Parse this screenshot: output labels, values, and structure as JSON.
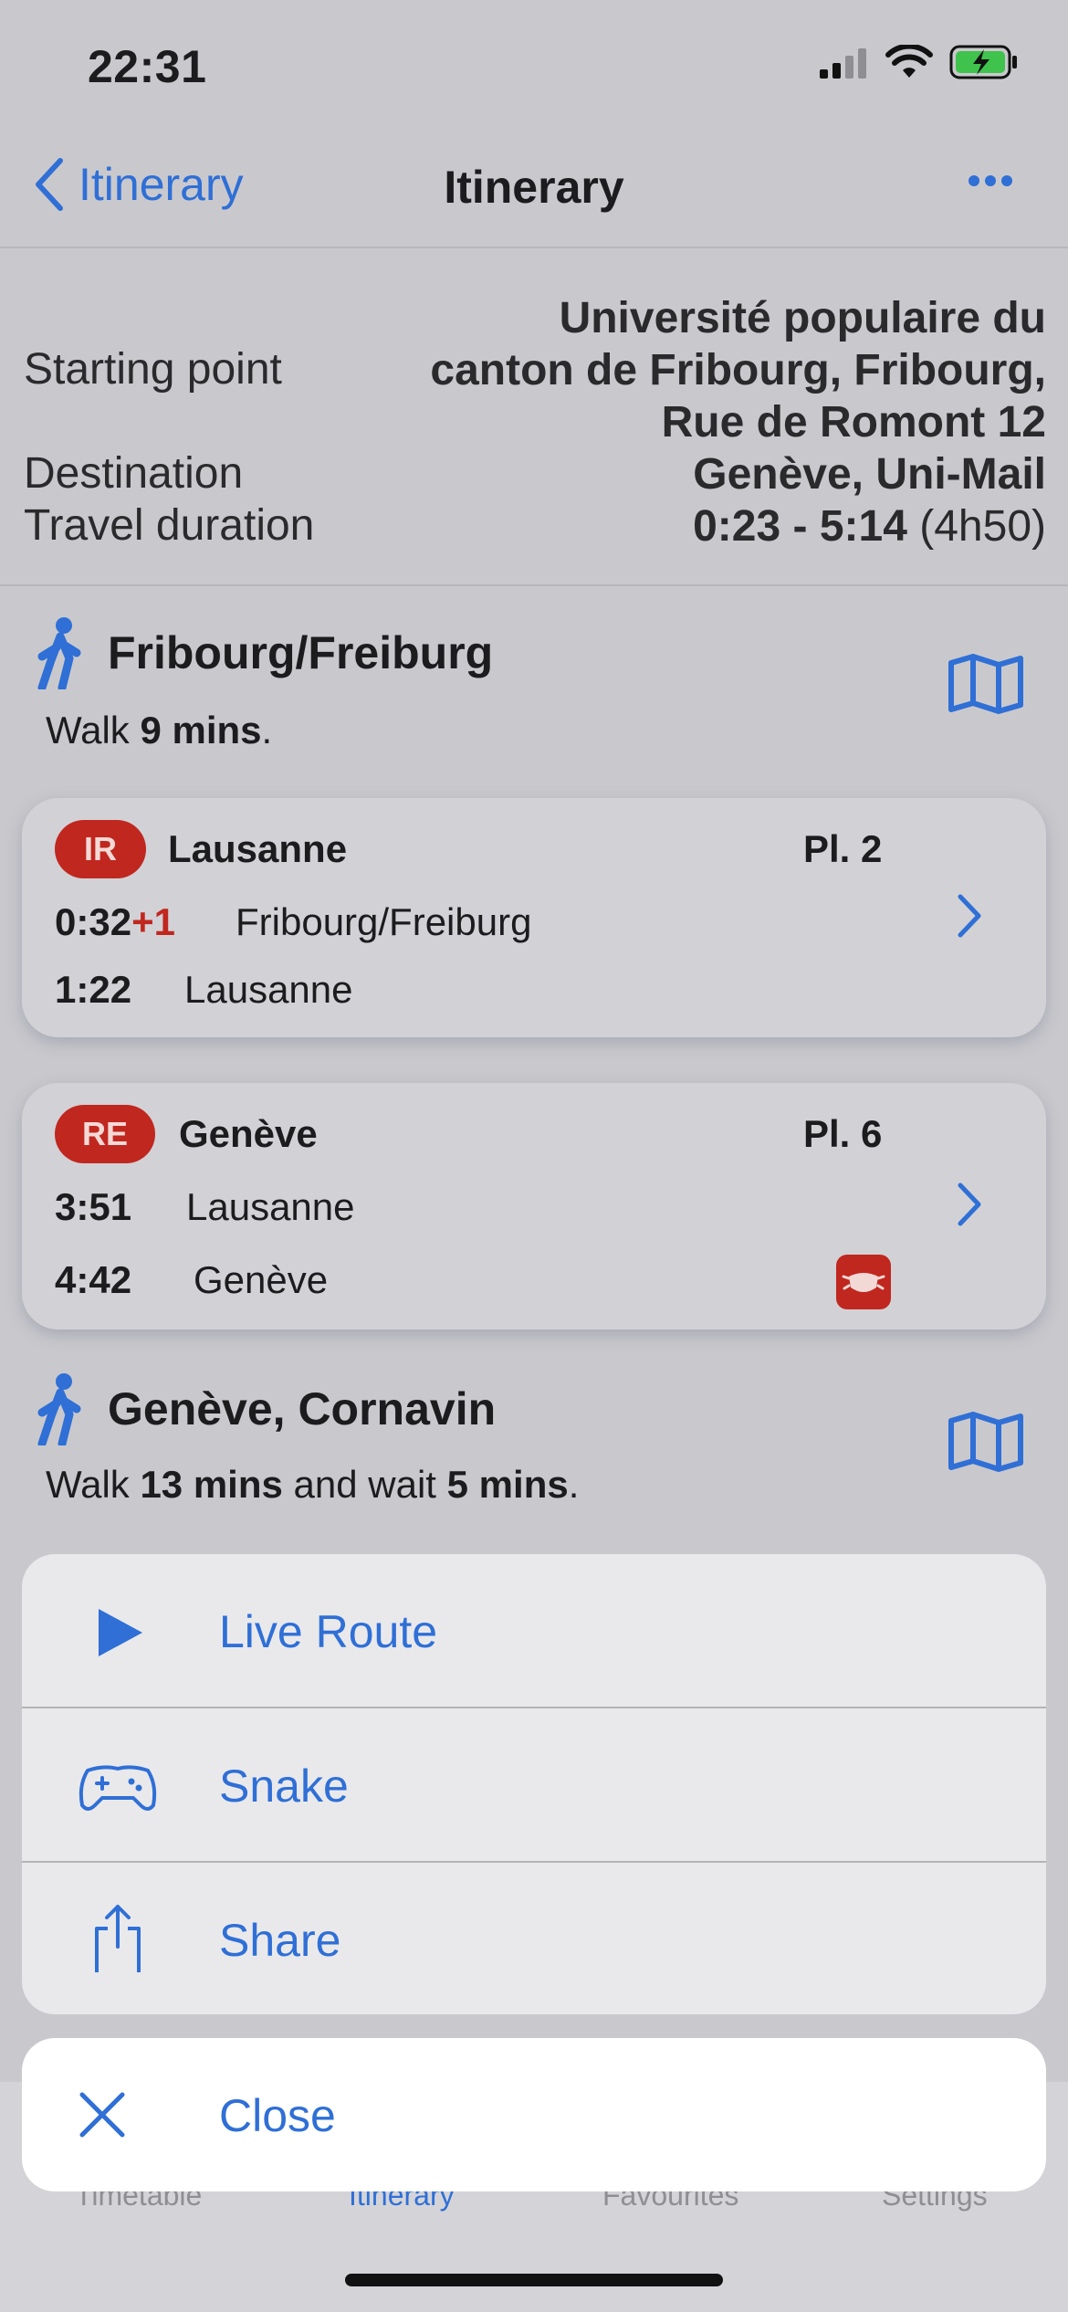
{
  "status": {
    "time": "22:31"
  },
  "nav": {
    "back_label": "Itinerary",
    "title": "Itinerary"
  },
  "summary": {
    "start_label": "Starting point",
    "start_line1": "Université populaire du",
    "start_line2": "canton de Fribourg, Fribourg,",
    "start_line3": "Rue de Romont 12",
    "dest_label": "Destination",
    "dest_value": "Genève, Uni-Mail",
    "duration_label": "Travel duration",
    "duration_value": "0:23 - 5:14",
    "duration_extra": "(4h50)"
  },
  "walk1": {
    "title": "Fribourg/Freiburg",
    "desc_pre": "Walk ",
    "desc_bold": "9 mins",
    "desc_post": "."
  },
  "trip1": {
    "badge": "IR",
    "direction": "Lausanne",
    "platform": "Pl. 2",
    "dep_time": "0:32",
    "dep_delay": "+1",
    "dep_station": "Fribourg/Freiburg",
    "arr_time": "1:22",
    "arr_station": "Lausanne"
  },
  "trip2": {
    "badge": "RE",
    "direction": "Genève",
    "platform": "Pl. 6",
    "dep_time": "3:51",
    "dep_station": "Lausanne",
    "arr_time": "4:42",
    "arr_station": "Genève"
  },
  "walk2": {
    "title": "Genève, Cornavin",
    "desc_pre": "Walk ",
    "desc_bold1": "13 mins",
    "desc_mid": " and wait ",
    "desc_bold2": "5 mins",
    "desc_post": "."
  },
  "sheet": {
    "items": [
      {
        "label": "Live Route",
        "icon": "play-icon"
      },
      {
        "label": "Snake",
        "icon": "gamepad-icon"
      },
      {
        "label": "Share",
        "icon": "share-icon"
      }
    ],
    "close_label": "Close"
  },
  "tabbar": {
    "tabs": [
      "Timetable",
      "Itinerary",
      "Favourites",
      "Settings"
    ]
  },
  "colors": {
    "accent": "#2f6fd6",
    "badge": "#c0271f",
    "background": "#c9c9cd"
  }
}
